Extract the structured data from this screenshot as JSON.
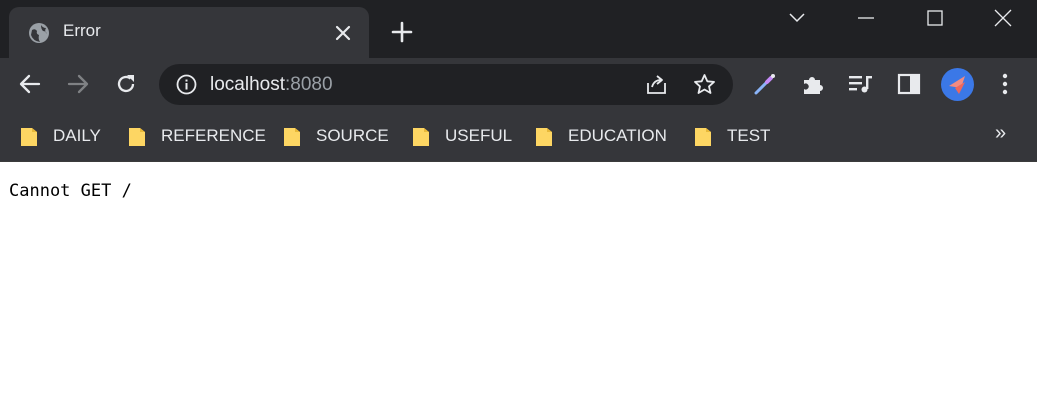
{
  "tab": {
    "title": "Error"
  },
  "omnibox": {
    "host": "localhost",
    "port": ":8080"
  },
  "bookmarks": [
    {
      "label": "DAILY"
    },
    {
      "label": "REFERENCE"
    },
    {
      "label": "SOURCE"
    },
    {
      "label": "USEFUL"
    },
    {
      "label": "EDUCATION"
    },
    {
      "label": "TEST"
    }
  ],
  "bookmarks_overflow": "»",
  "page": {
    "body_text": "Cannot GET /"
  },
  "colors": {
    "frame": "#202124",
    "toolbar": "#35363a",
    "folder": "#fdd663",
    "avatar": "#3b78e7"
  },
  "icons": [
    "globe-icon",
    "close-icon",
    "plus-icon",
    "back-icon",
    "forward-icon",
    "reload-icon",
    "info-icon",
    "share-icon",
    "star-icon",
    "eyedropper-icon",
    "puzzle-icon",
    "media-icon",
    "side-panel-icon",
    "menu-icon",
    "folder-icon"
  ]
}
